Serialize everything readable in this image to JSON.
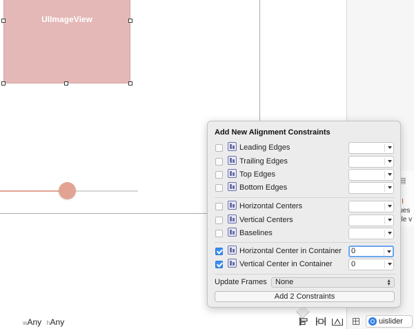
{
  "canvas": {
    "image_view_label": "UIImageView",
    "slider": {
      "value_fraction": 0.49
    },
    "inspector_snippet": {
      "lines": [
        "- ",
        "lues",
        "gle v"
      ]
    }
  },
  "popover": {
    "title": "Add New Alignment Constraints",
    "group1": [
      {
        "label": "Leading Edges",
        "checked": false,
        "value": ""
      },
      {
        "label": "Trailing Edges",
        "checked": false,
        "value": ""
      },
      {
        "label": "Top Edges",
        "checked": false,
        "value": ""
      },
      {
        "label": "Bottom Edges",
        "checked": false,
        "value": ""
      }
    ],
    "group2": [
      {
        "label": "Horizontal Centers",
        "checked": false,
        "value": ""
      },
      {
        "label": "Vertical Centers",
        "checked": false,
        "value": ""
      },
      {
        "label": "Baselines",
        "checked": false,
        "value": ""
      }
    ],
    "group3": [
      {
        "label": "Horizontal Center in Container",
        "checked": true,
        "value": "0"
      },
      {
        "label": "Vertical Center in Container",
        "checked": true,
        "value": "0"
      }
    ],
    "update_frames_label": "Update Frames",
    "update_frames_value": "None",
    "add_button_label": "Add 2 Constraints"
  },
  "bottom_bar": {
    "size_class": {
      "w_prefix": "w",
      "w_value": "Any",
      "h_prefix": "h",
      "h_value": "Any"
    },
    "icons": [
      "align-icon",
      "pin-icon",
      "resolve-issues-icon",
      "grid-icon"
    ],
    "search_value": "uislider"
  },
  "colors": {
    "image_view_fill": "#e3b8b6",
    "slider_tint": "#e3a393",
    "checkbox_checked": "#3b8ef0",
    "focus_ring": "#6aa4ee"
  }
}
